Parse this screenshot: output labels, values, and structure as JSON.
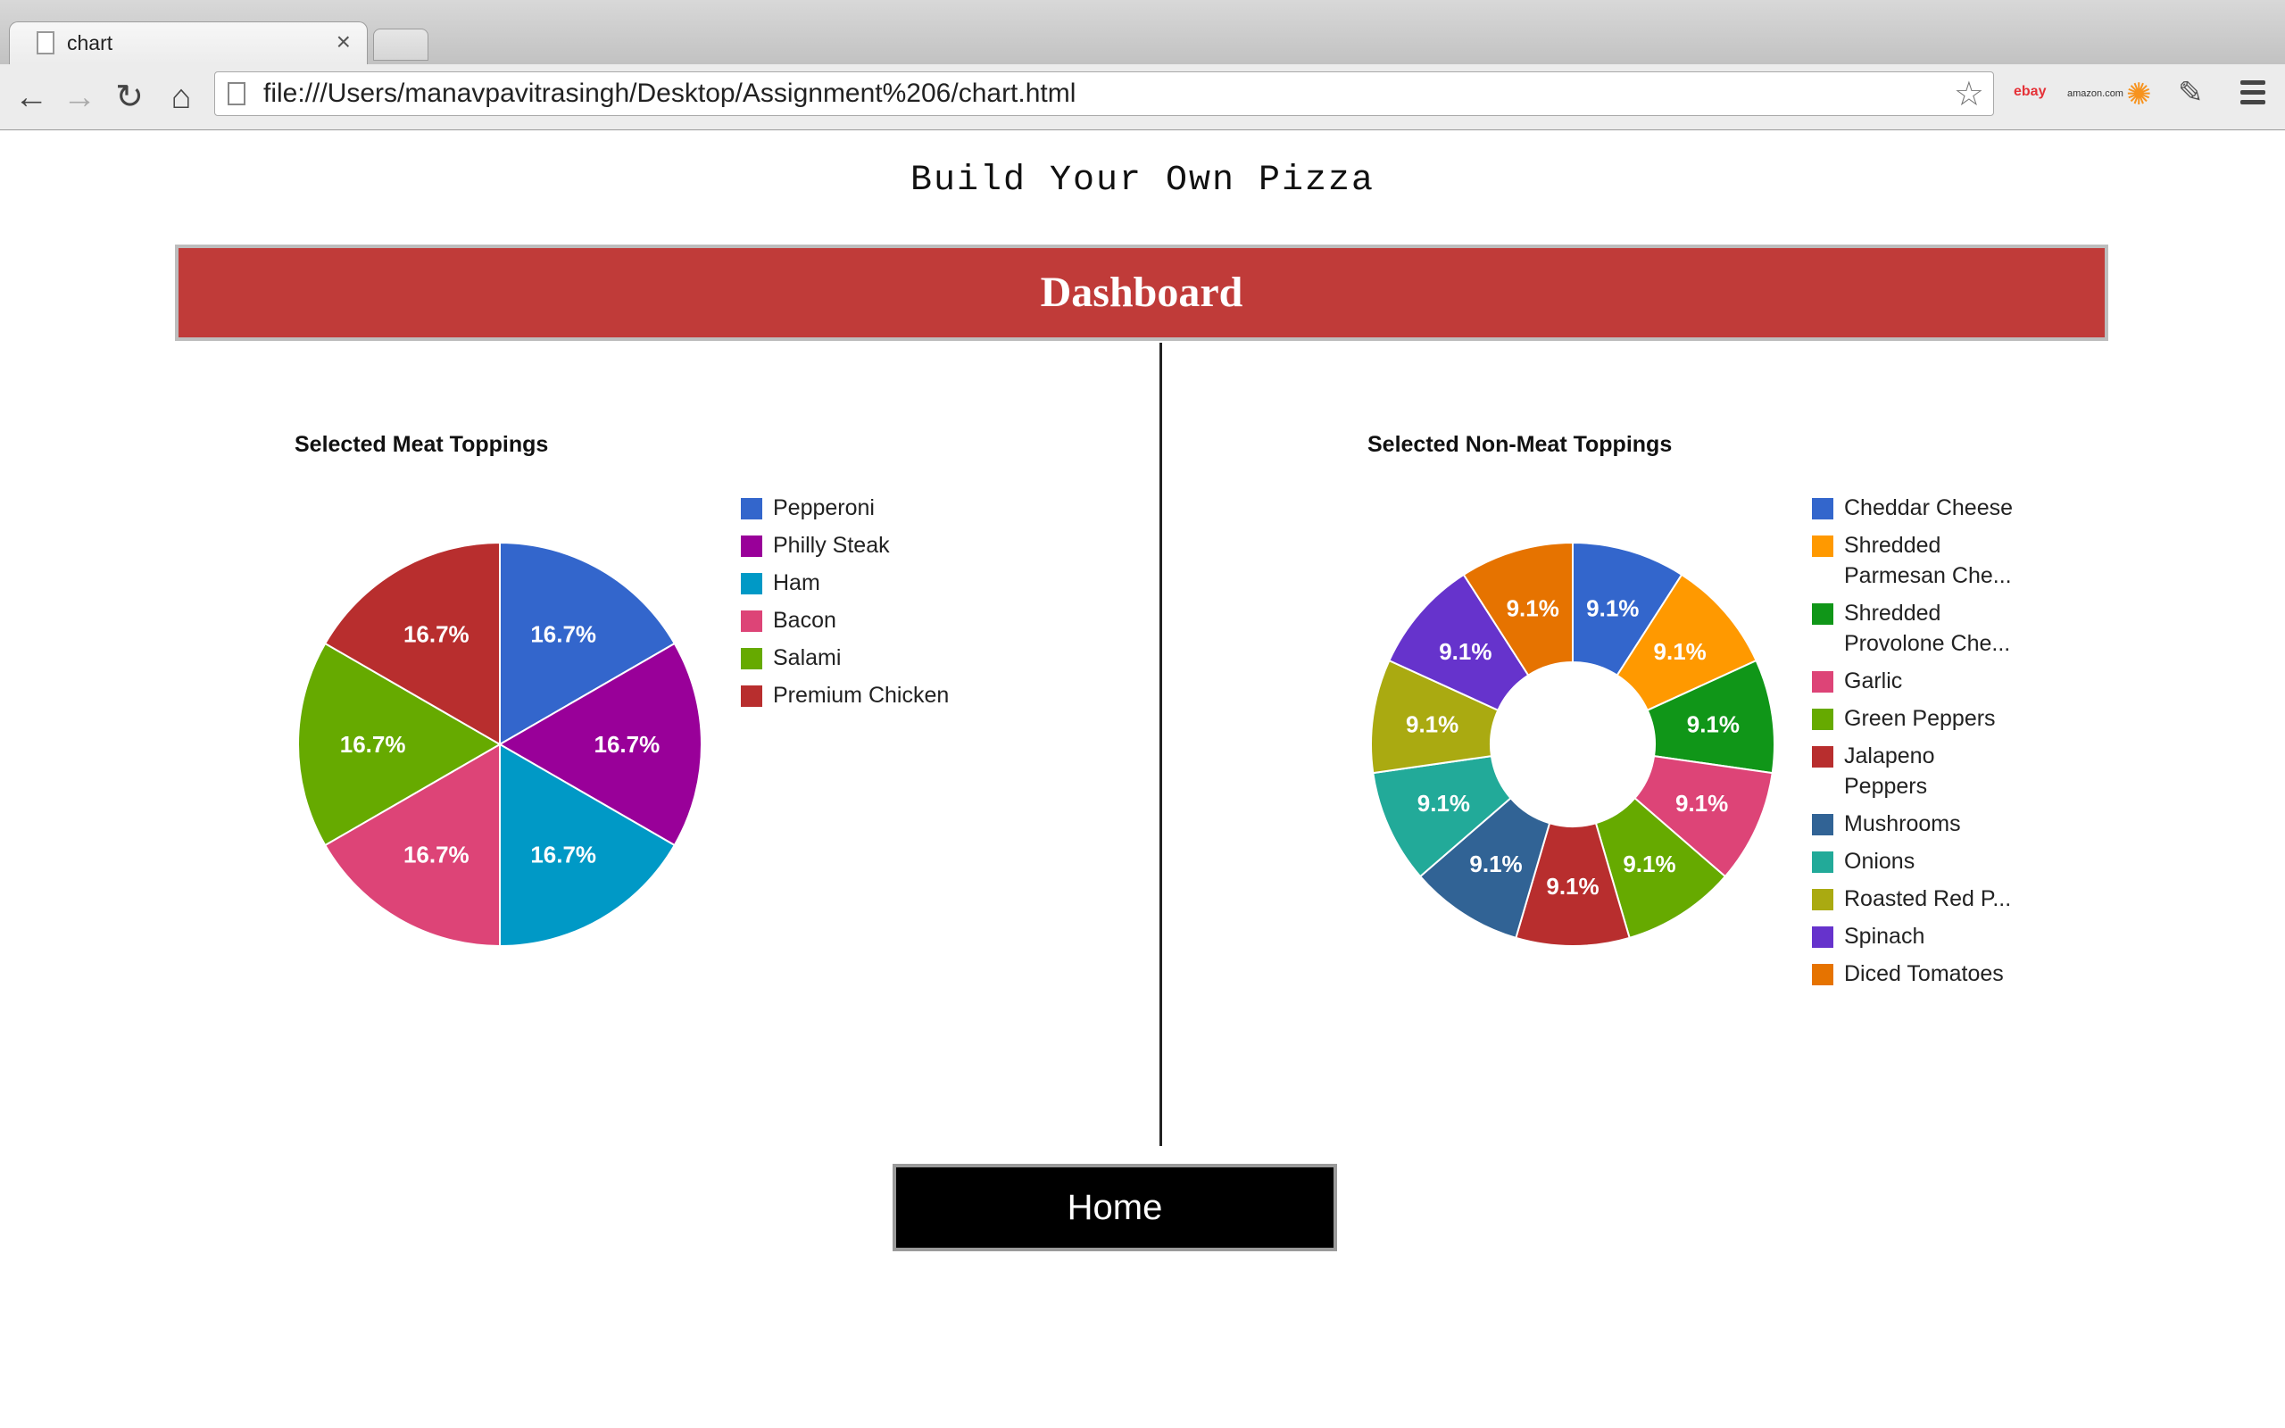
{
  "browser": {
    "tab_title": "chart",
    "tab_close": "×",
    "url": "file:///Users/manavpavitrasingh/Desktop/Assignment%206/chart.html",
    "nav_icons": [
      "back-arrow-icon",
      "forward-arrow-icon",
      "reload-icon",
      "home-icon"
    ],
    "extensions": [
      "ebay-icon",
      "amazon-icon",
      "avast-icon",
      "eyedropper-icon"
    ],
    "extension_labels": {
      "ebay": "ebay",
      "amazon": "amazon.com"
    }
  },
  "page": {
    "title": "Build Your Own Pizza",
    "dashboard_label": "Dashboard",
    "home_label": "Home"
  },
  "chart_data": [
    {
      "type": "pie",
      "title": "Selected Meat Toppings",
      "categories": [
        "Pepperoni",
        "Philly Steak",
        "Ham",
        "Bacon",
        "Salami",
        "Premium Chicken"
      ],
      "values": [
        1,
        1,
        1,
        1,
        1,
        1
      ],
      "labels": [
        "16.7%",
        "16.7%",
        "16.7%",
        "16.7%",
        "16.7%",
        "16.7%"
      ],
      "colors": [
        "#3366cc",
        "#990099",
        "#0099c6",
        "#dd4477",
        "#66aa00",
        "#b82e2e"
      ],
      "legend": "right"
    },
    {
      "type": "pie",
      "donut": true,
      "title": "Selected Non-Meat Toppings",
      "categories": [
        "Cheddar Cheese",
        "Shredded Parmesan Che...",
        "Shredded Provolone Che...",
        "Garlic",
        "Green Peppers",
        "Jalapeno Peppers",
        "Mushrooms",
        "Onions",
        "Roasted Red P...",
        "Spinach",
        "Diced Tomatoes"
      ],
      "legend_lines": [
        [
          "Cheddar Cheese"
        ],
        [
          "Shredded",
          "Parmesan Che..."
        ],
        [
          "Shredded",
          "Provolone Che..."
        ],
        [
          "Garlic"
        ],
        [
          "Green Peppers"
        ],
        [
          "Jalapeno",
          "Peppers"
        ],
        [
          "Mushrooms"
        ],
        [
          "Onions"
        ],
        [
          "Roasted Red P..."
        ],
        [
          "Spinach"
        ],
        [
          "Diced Tomatoes"
        ]
      ],
      "values": [
        1,
        1,
        1,
        1,
        1,
        1,
        1,
        1,
        1,
        1,
        1
      ],
      "labels": [
        "9.1%",
        "9.1%",
        "9.1%",
        "9.1%",
        "9.1%",
        "9.1%",
        "9.1%",
        "9.1%",
        "9.1%",
        "9.1%",
        "9.1%"
      ],
      "colors": [
        "#3366cc",
        "#ff9900",
        "#109618",
        "#dd4477",
        "#66aa00",
        "#b82e2e",
        "#316395",
        "#22aa99",
        "#aaaa11",
        "#6633cc",
        "#e67300"
      ],
      "legend": "right"
    }
  ]
}
